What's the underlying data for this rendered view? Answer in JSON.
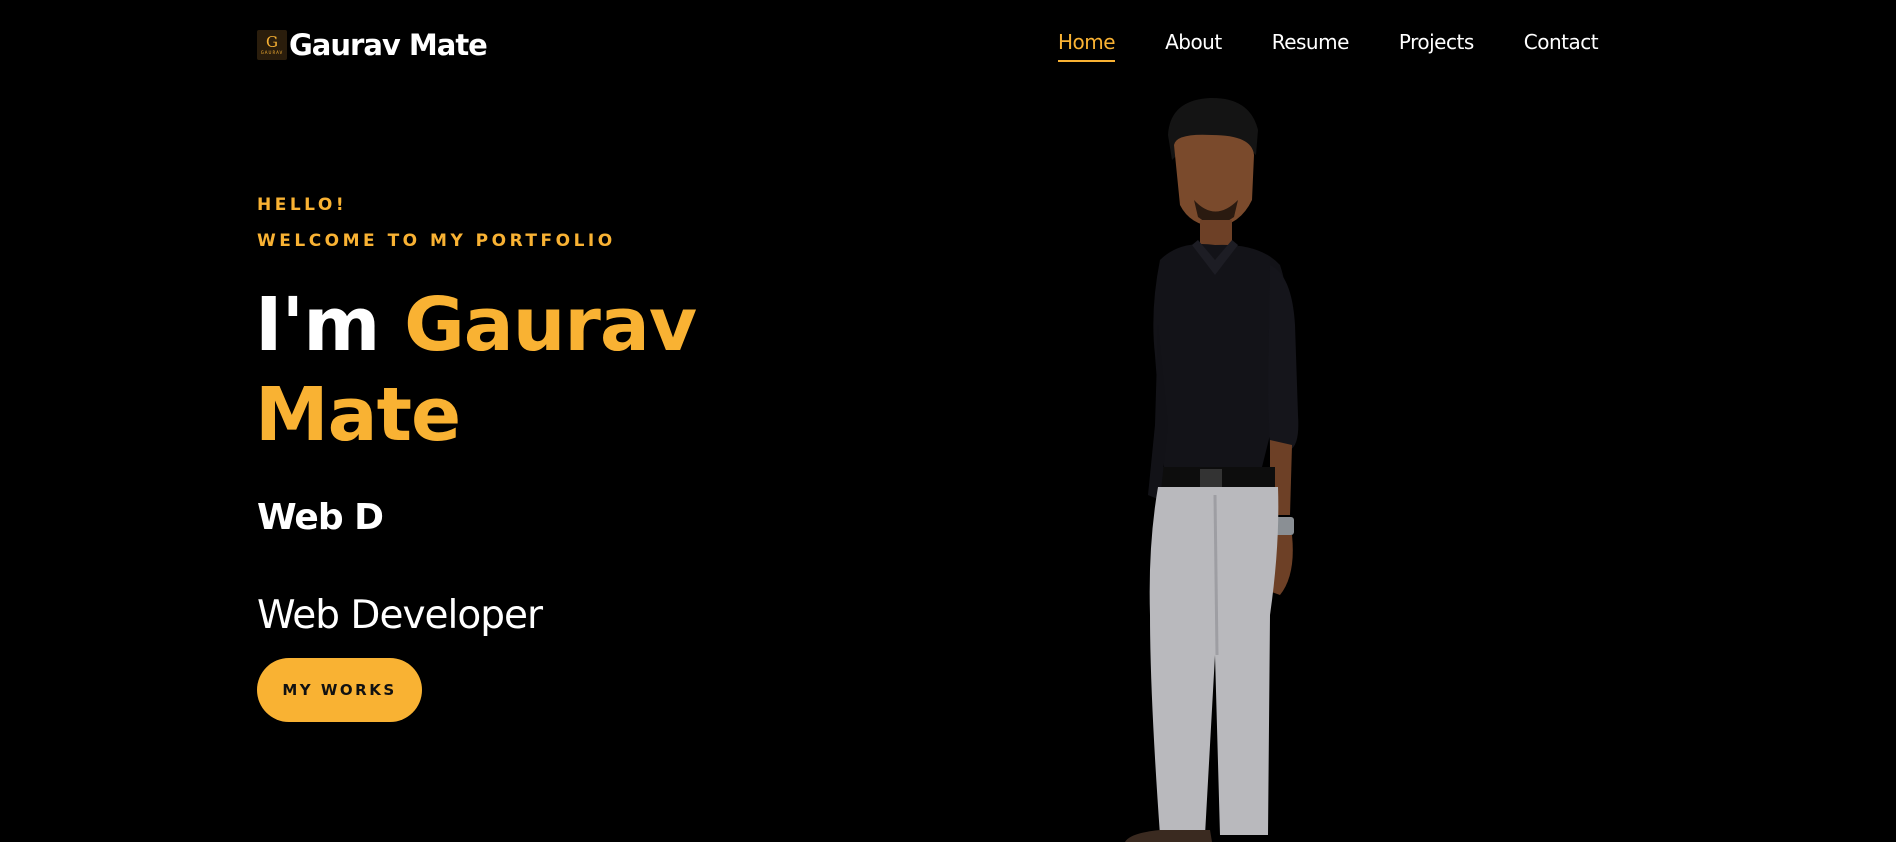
{
  "header": {
    "logo_mark_letter": "G",
    "logo_mark_sub": "GAURAV",
    "logo_text": "Gaurav Mate"
  },
  "nav": {
    "items": [
      {
        "label": "Home",
        "active": true
      },
      {
        "label": "About",
        "active": false
      },
      {
        "label": "Resume",
        "active": false
      },
      {
        "label": "Projects",
        "active": false
      },
      {
        "label": "Contact",
        "active": false
      }
    ]
  },
  "hero": {
    "greeting": "HELLO!",
    "welcome": "WELCOME TO MY PORTFOLIO",
    "intro": "I'm ",
    "name_first": "Gaurav",
    "name_last": "Mate",
    "typed_text": "Web D",
    "role": "Web Developer",
    "cta_label": "MY WORKS"
  },
  "colors": {
    "accent": "#f9b233",
    "background": "#000000",
    "text": "#ffffff"
  },
  "icons": {
    "logo": "g-monogram-logo",
    "portrait": "person-portrait-image"
  }
}
